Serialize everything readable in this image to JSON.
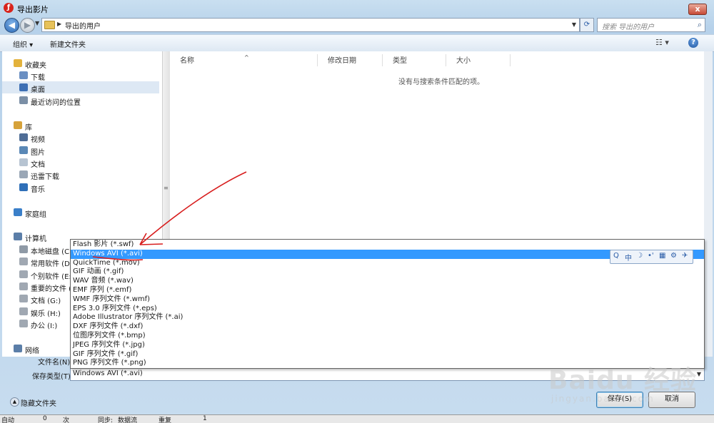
{
  "window": {
    "title": "导出影片",
    "close_glyph": "x"
  },
  "address": {
    "path": "导出的用户",
    "search_placeholder": "搜索 导出的用户"
  },
  "toolbar": {
    "organize": "组织 ▾",
    "new_folder": "新建文件夹",
    "view_glyph": "☷ ▾",
    "help_glyph": "?"
  },
  "sidebar": {
    "items": [
      {
        "label": "收藏夹",
        "icon": "star-icon",
        "color": "#e3b23c"
      },
      {
        "label": "下载",
        "icon": "download-folder-icon",
        "color": "#6a8fc2"
      },
      {
        "label": "桌面",
        "icon": "desktop-icon",
        "color": "#3d6fb4"
      },
      {
        "label": "最近访问的位置",
        "icon": "recent-places-icon",
        "color": "#7b8fa6"
      },
      {
        "label": "库",
        "icon": "library-icon",
        "color": "#d6a23a"
      },
      {
        "label": "视频",
        "icon": "video-icon",
        "color": "#4f6d96"
      },
      {
        "label": "图片",
        "icon": "pictures-icon",
        "color": "#5a88b6"
      },
      {
        "label": "文档",
        "icon": "documents-icon",
        "color": "#b7c4d2"
      },
      {
        "label": "迅雷下载",
        "icon": "thunder-download-icon",
        "color": "#9aa7b6"
      },
      {
        "label": "音乐",
        "icon": "music-icon",
        "color": "#2f6fb8"
      },
      {
        "label": "家庭组",
        "icon": "homegroup-icon",
        "color": "#3a7fc9"
      },
      {
        "label": "计算机",
        "icon": "computer-icon",
        "color": "#5b7ea8"
      },
      {
        "label": "本地磁盘 (C:)",
        "icon": "drive-c-icon",
        "color": "#8f9aa6"
      },
      {
        "label": "常用软件 (D:)",
        "icon": "drive-icon",
        "color": "#a0a8b2"
      },
      {
        "label": "个别软件 (E:)",
        "icon": "drive-icon",
        "color": "#a0a8b2"
      },
      {
        "label": "重要的文件 (F:)",
        "icon": "drive-icon",
        "color": "#a0a8b2"
      },
      {
        "label": "文档 (G:)",
        "icon": "drive-icon",
        "color": "#a0a8b2"
      },
      {
        "label": "娱乐 (H:)",
        "icon": "drive-icon",
        "color": "#a0a8b2"
      },
      {
        "label": "办公 (I:)",
        "icon": "drive-icon",
        "color": "#a0a8b2"
      },
      {
        "label": "网络",
        "icon": "network-icon",
        "color": "#5b7ea8"
      }
    ]
  },
  "columns": [
    {
      "label": "名称"
    },
    {
      "label": "修改日期"
    },
    {
      "label": "类型"
    },
    {
      "label": "大小"
    }
  ],
  "empty_message": "没有与搜索条件匹配的项。",
  "file_types": [
    "Flash 影片 (*.swf)",
    "Windows AVI (*.avi)",
    "QuickTime (*.mov)",
    "GIF 动画 (*.gif)",
    "WAV 音频 (*.wav)",
    "EMF 序列 (*.emf)",
    "WMF 序列文件 (*.wmf)",
    "EPS 3.0 序列文件 (*.eps)",
    "Adobe Illustrator 序列文件 (*.ai)",
    "DXF 序列文件 (*.dxf)",
    "位图序列文件 (*.bmp)",
    "JPEG 序列文件 (*.jpg)",
    "GIF 序列文件 (*.gif)",
    "PNG 序列文件 (*.png)"
  ],
  "selected_type_index": 1,
  "ime": {
    "items": [
      "Q",
      "中",
      "☽",
      "•'",
      "▦",
      "⚙",
      "✈"
    ]
  },
  "form": {
    "filename_label": "文件名(N):",
    "savetype_label": "保存类型(T):",
    "savetype_value": "Windows AVI (*.avi)"
  },
  "bottom": {
    "hide_folders": "隐藏文件夹",
    "save": "保存(S)",
    "cancel": "取消"
  },
  "appstrip": [
    "自动",
    "0",
    "次",
    "同步:",
    "数据流",
    "重复",
    "1"
  ],
  "watermark": {
    "logo": "Baidu 经验",
    "url": "jingyan.baidu.com"
  },
  "colors": {
    "selection": "#3399ff",
    "annotation": "#d81e1e"
  }
}
